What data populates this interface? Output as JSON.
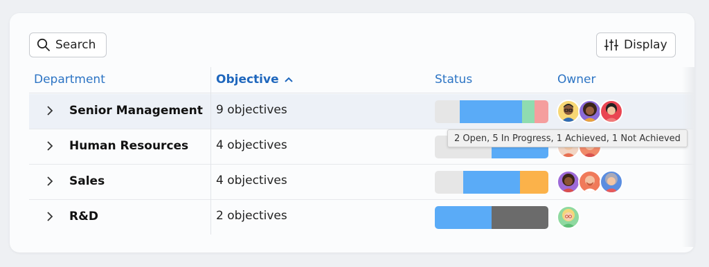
{
  "toolbar": {
    "search_label": "Search",
    "display_label": "Display"
  },
  "columns": {
    "department": "Department",
    "objective": "Objective",
    "status": "Status",
    "owner": "Owner"
  },
  "rows": [
    {
      "department": "Senior Management",
      "objectives": "9 objectives",
      "status_segments": [
        {
          "status": "open",
          "fraction": 0.22,
          "color": "#e6e6e6"
        },
        {
          "status": "in-progress",
          "fraction": 0.55,
          "color": "#5aabf7"
        },
        {
          "status": "achieved",
          "fraction": 0.11,
          "color": "#8fdcb0"
        },
        {
          "status": "not-achieved",
          "fraction": 0.12,
          "color": "#f59e9e"
        }
      ],
      "owners": [
        "avatar-man-glasses",
        "avatar-woman-curly",
        "avatar-woman-red"
      ]
    },
    {
      "department": "Human Resources",
      "objectives": "4 objectives",
      "status_segments": [
        {
          "status": "open",
          "fraction": 0.5,
          "color": "#e6e6e6"
        },
        {
          "status": "in-progress",
          "fraction": 0.5,
          "color": "#5aabf7"
        }
      ],
      "owners": [
        "avatar-person-a",
        "avatar-person-b"
      ]
    },
    {
      "department": "Sales",
      "objectives": "4 objectives",
      "status_segments": [
        {
          "status": "open",
          "fraction": 0.25,
          "color": "#e6e6e6"
        },
        {
          "status": "in-progress",
          "fraction": 0.5,
          "color": "#5aabf7"
        },
        {
          "status": "other",
          "fraction": 0.25,
          "color": "#fbb24a"
        }
      ],
      "owners": [
        "avatar-woman-dark",
        "avatar-man-beard",
        "avatar-woman-gray"
      ]
    },
    {
      "department": "R&D",
      "objectives": "2 objectives",
      "status_segments": [
        {
          "status": "in-progress",
          "fraction": 0.5,
          "color": "#5aabf7"
        },
        {
          "status": "other",
          "fraction": 0.5,
          "color": "#6b6b6b"
        }
      ],
      "owners": [
        "avatar-blonde-glasses"
      ]
    }
  ],
  "tooltip": {
    "text": "2 Open, 5 In Progress, 1 Achieved, 1 Not Achieved"
  }
}
